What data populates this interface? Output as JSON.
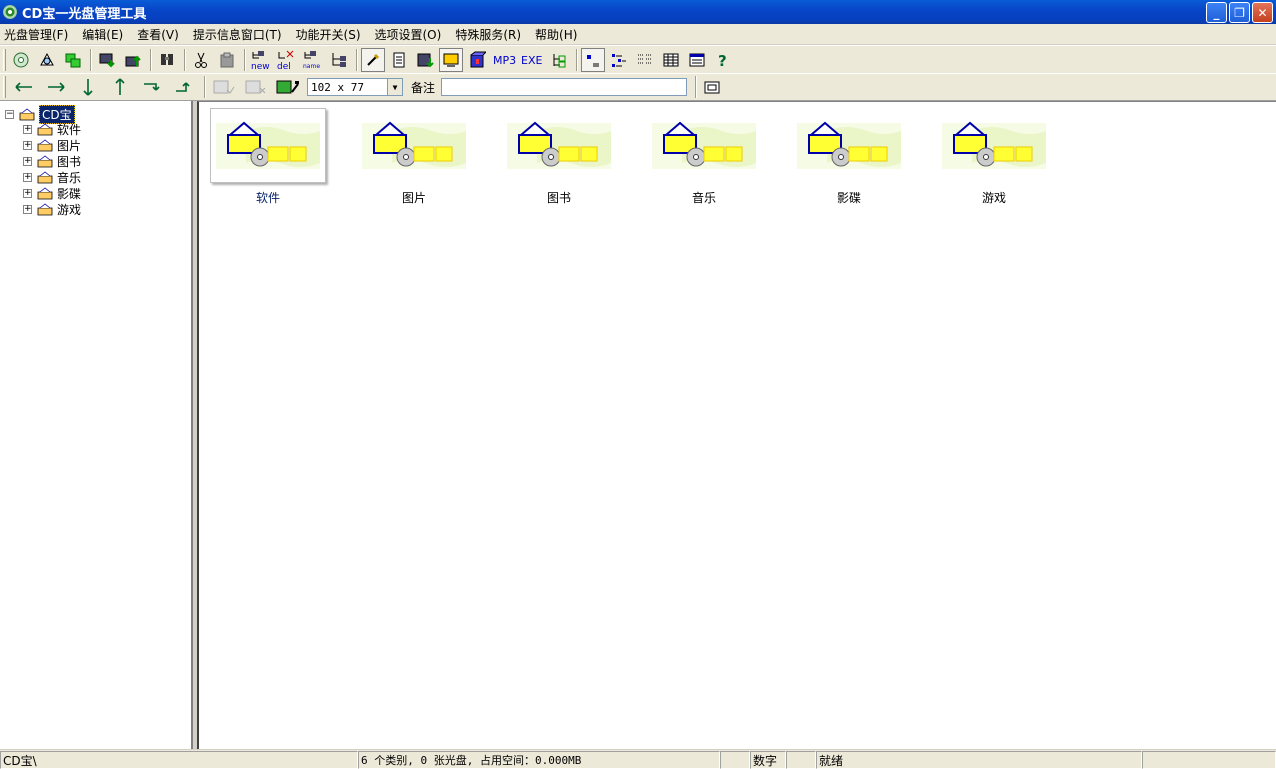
{
  "window": {
    "title": "CD宝一光盘管理工具",
    "buttons": {
      "minimize": "_",
      "maximize": "❐",
      "close": "✕"
    }
  },
  "menu": [
    "光盘管理(F)",
    "编辑(E)",
    "查看(V)",
    "提示信息窗口(T)",
    "功能开关(S)",
    "选项设置(O)",
    "特殊服务(R)",
    "帮助(H)"
  ],
  "toolbar1": {
    "text_buttons": {
      "new": "new",
      "del": "del",
      "name": "name",
      "mp3": "MP3",
      "exe": "EXE"
    }
  },
  "toolbar2": {
    "thumb_size": "102 x 77",
    "note_label": "备注",
    "note_value": ""
  },
  "tree": {
    "root": "CD宝",
    "children": [
      "软件",
      "图片",
      "图书",
      "音乐",
      "影碟",
      "游戏"
    ]
  },
  "categories": [
    "软件",
    "图片",
    "图书",
    "音乐",
    "影碟",
    "游戏"
  ],
  "statusbar": {
    "path": "CD宝\\",
    "summary": "6 个类别, 0 张光盘, 占用空间：0.000MB",
    "numlock": "数字",
    "state": "就绪"
  },
  "colors": {
    "titlebar": "#0746c8",
    "selection": "#0a246a",
    "chrome": "#ece9d8"
  }
}
